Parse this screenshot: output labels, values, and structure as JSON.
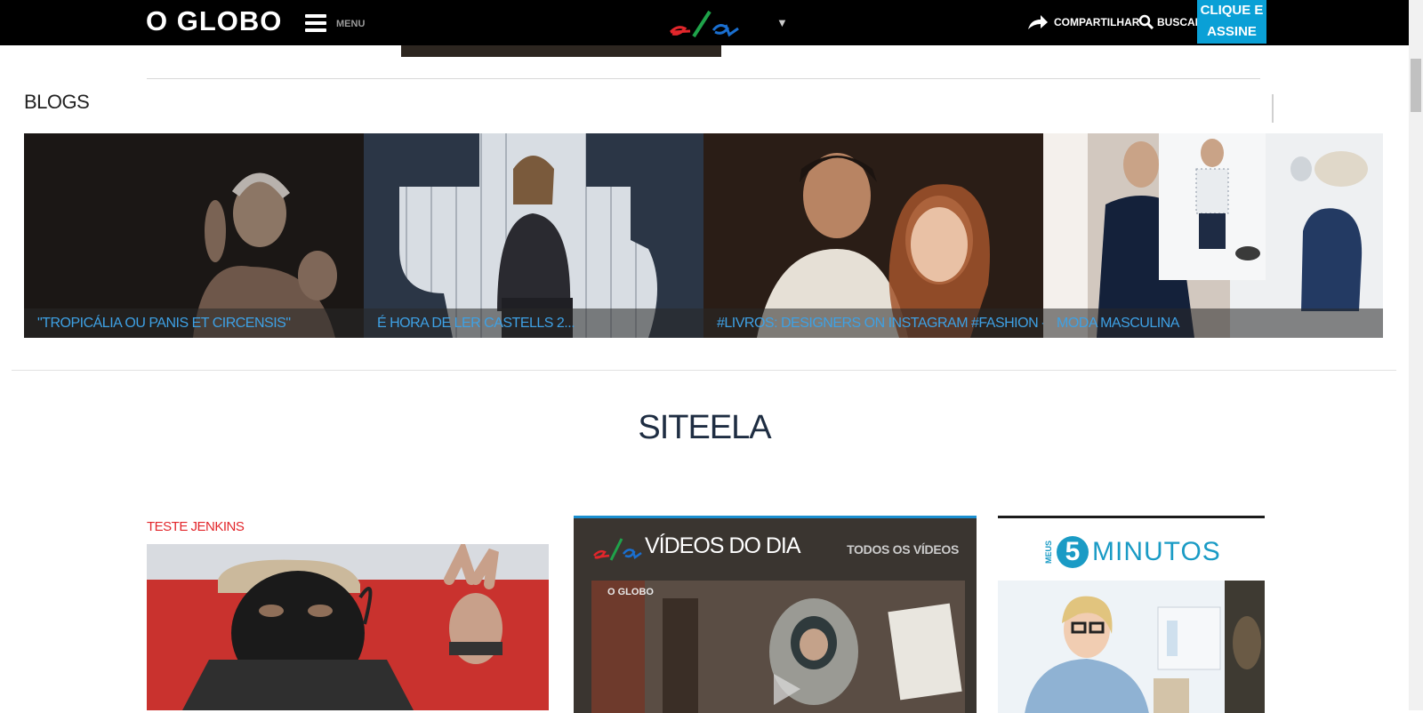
{
  "header": {
    "logo_text": "O GLOBO",
    "menu_label": "MENU",
    "ela_logo_name": "ela",
    "dropdown_glyph": "▼",
    "share_label": "COMPARTILHAR",
    "search_label": "BUSCAR",
    "subscribe_line1": "CLIQUE E",
    "subscribe_line2": "ASSINE",
    "accent_color": "#0aa0d6"
  },
  "blogs": {
    "title": "BLOGS",
    "items": [
      {
        "caption": "\"TROPICÁLIA OU PANIS ET CIRCENSIS\""
      },
      {
        "caption": "É HORA DE LER CASTELLS 2..."
      },
      {
        "caption": "#LIVROS: DESIGNERS ON INSTAGRAM #FASHION - SEDA"
      },
      {
        "caption": "MODA MASCULINA"
      }
    ],
    "caption_color": "#3ea1e5"
  },
  "section": {
    "title": "SITEELA"
  },
  "teste": {
    "label": "TESTE JENKINS"
  },
  "videos": {
    "title": "VÍDEOS DO DIA",
    "all_link": "TODOS OS VÍDEOS",
    "thumb_brand": "O GLOBO"
  },
  "minutos": {
    "meus": "MEUS",
    "number": "5",
    "word": "MINUTOS"
  }
}
